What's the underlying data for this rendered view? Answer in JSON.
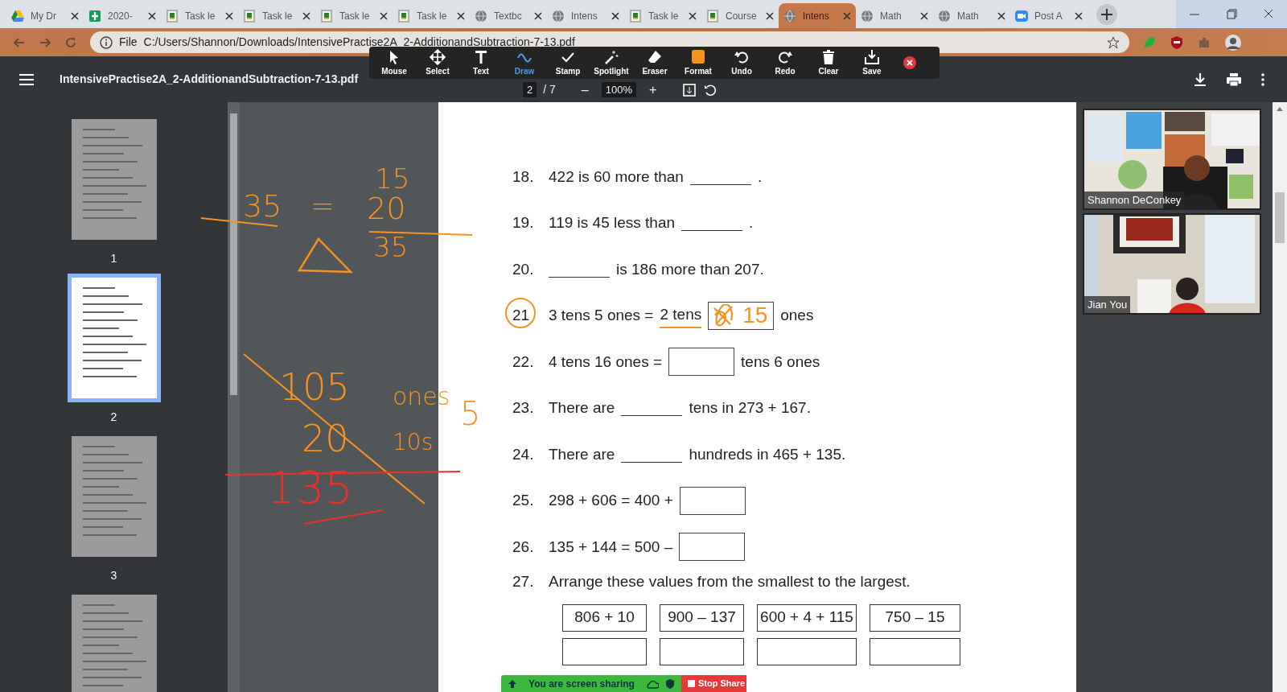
{
  "browser": {
    "tabs": [
      {
        "title": "My Dr",
        "selected": false
      },
      {
        "title": "2020-",
        "selected": false
      },
      {
        "title": "Task le",
        "selected": false
      },
      {
        "title": "Task le",
        "selected": false
      },
      {
        "title": "Task le",
        "selected": false
      },
      {
        "title": "Task le",
        "selected": false
      },
      {
        "title": "Textbc",
        "selected": false
      },
      {
        "title": "Intens",
        "selected": false
      },
      {
        "title": "Task le",
        "selected": false
      },
      {
        "title": "Course",
        "selected": false
      },
      {
        "title": "Intens",
        "selected": true
      },
      {
        "title": "Math",
        "selected": false
      },
      {
        "title": "Math",
        "selected": false
      },
      {
        "title": "Post A",
        "selected": false
      }
    ],
    "address": {
      "scheme": "File",
      "url": "C:/Users/Shannon/Downloads/IntensivePractise2A_2-AdditionandSubtraction-7-13.pdf"
    }
  },
  "zoom_toolbar": {
    "tools": [
      {
        "label": "Mouse",
        "selected": false
      },
      {
        "label": "Select",
        "selected": false
      },
      {
        "label": "Text",
        "selected": false
      },
      {
        "label": "Draw",
        "selected": true
      },
      {
        "label": "Stamp",
        "selected": false
      },
      {
        "label": "Spotlight",
        "selected": false
      },
      {
        "label": "Eraser",
        "selected": false
      },
      {
        "label": "Format",
        "selected": false
      },
      {
        "label": "Undo",
        "selected": false
      },
      {
        "label": "Redo",
        "selected": false
      },
      {
        "label": "Clear",
        "selected": false
      },
      {
        "label": "Save",
        "selected": false
      }
    ]
  },
  "pdf_viewer": {
    "title": "IntensivePractise2A_2-AdditionandSubtraction-7-13.pdf",
    "page": "2",
    "page_total": "/ 7",
    "zoom": "100%",
    "zoom_out": "–",
    "zoom_in": "+"
  },
  "thumbnails": [
    {
      "label": "1",
      "selected": false
    },
    {
      "label": "2",
      "selected": true
    },
    {
      "label": "3",
      "selected": false
    },
    {
      "selected": false
    }
  ],
  "worksheet": {
    "questions": [
      {
        "number": "18.",
        "circled": false,
        "parts": [
          {
            "kind": "text",
            "text": "422 is 60 more than",
            "underlined": false
          },
          {
            "kind": "blank"
          },
          {
            "kind": "text",
            "text": ".",
            "underlined": false
          }
        ]
      },
      {
        "number": "19.",
        "circled": false,
        "parts": [
          {
            "kind": "text",
            "text": "119 is 45 less than",
            "underlined": false
          },
          {
            "kind": "blank"
          },
          {
            "kind": "text",
            "text": ".",
            "underlined": false
          }
        ]
      },
      {
        "number": "20.",
        "circled": false,
        "parts": [
          {
            "kind": "blank"
          },
          {
            "kind": "text",
            "text": "is 186 more than 207.",
            "underlined": false
          }
        ]
      },
      {
        "number": "21",
        "circled": true,
        "parts": [
          {
            "kind": "text",
            "text": "3 tens 5 ones =",
            "underlined": false
          },
          {
            "kind": "text",
            "text": "2 tens",
            "underlined": true
          },
          {
            "kind": "box",
            "value": "15",
            "scribbled": true
          },
          {
            "kind": "text",
            "text": "ones",
            "underlined": false
          }
        ]
      },
      {
        "number": "22.",
        "circled": false,
        "parts": [
          {
            "kind": "text",
            "text": "4 tens 16 ones =",
            "underlined": false
          },
          {
            "kind": "box",
            "scribbled": false
          },
          {
            "kind": "text",
            "text": "tens 6 ones",
            "underlined": false
          }
        ]
      },
      {
        "number": "23.",
        "circled": false,
        "parts": [
          {
            "kind": "text",
            "text": "There are",
            "underlined": false
          },
          {
            "kind": "blank"
          },
          {
            "kind": "text",
            "text": "tens in 273 + 167.",
            "underlined": false
          }
        ]
      },
      {
        "number": "24.",
        "circled": false,
        "parts": [
          {
            "kind": "text",
            "text": "There are",
            "underlined": false
          },
          {
            "kind": "blank"
          },
          {
            "kind": "text",
            "text": "hundreds in 465 + 135.",
            "underlined": false
          }
        ]
      },
      {
        "number": "25.",
        "circled": false,
        "parts": [
          {
            "kind": "text",
            "text": "298 + 606 = 400 +",
            "underlined": false
          },
          {
            "kind": "box",
            "scribbled": false
          }
        ]
      },
      {
        "number": "26.",
        "circled": false,
        "parts": [
          {
            "kind": "text",
            "text": "135 + 144 = 500 –",
            "underlined": false
          },
          {
            "kind": "box",
            "scribbled": false
          }
        ]
      },
      {
        "number": "27.",
        "circled": false,
        "parts": [
          {
            "kind": "text",
            "text": "Arrange these values from the smallest to the largest.",
            "underlined": false
          }
        ],
        "value_boxes": [
          "806 + 10",
          "900 – 137",
          "600 + 4 + 115",
          "750 – 15"
        ]
      }
    ]
  },
  "annotations": [
    {
      "kind": "text",
      "text": "15",
      "color": "#f7931e"
    },
    {
      "kind": "text",
      "text": "35",
      "color": "#f7931e"
    },
    {
      "kind": "text",
      "text": "=",
      "color": "#f7931e"
    },
    {
      "kind": "text",
      "text": "20",
      "color": "#f7931e"
    },
    {
      "kind": "text",
      "text": "35",
      "color": "#f7931e"
    },
    {
      "kind": "line",
      "color": "#f7931e"
    },
    {
      "kind": "line",
      "color": "#f7931e"
    },
    {
      "kind": "triangle",
      "color": "#f7931e"
    },
    {
      "kind": "text",
      "text": "105",
      "color": "#f7931e"
    },
    {
      "kind": "text",
      "text": "ones",
      "color": "#f7931e"
    },
    {
      "kind": "text",
      "text": "5",
      "color": "#f7931e"
    },
    {
      "kind": "text",
      "text": "20",
      "color": "#f7931e"
    },
    {
      "kind": "text",
      "text": "10s",
      "color": "#f7931e"
    },
    {
      "kind": "line",
      "color": "#f7931e"
    },
    {
      "kind": "line",
      "color": "#e8312a"
    },
    {
      "kind": "text",
      "text": "135",
      "color": "#e8312a"
    },
    {
      "kind": "line",
      "color": "#e8312a"
    }
  ],
  "participants": [
    {
      "name": "Shannon DeConkey"
    },
    {
      "name": "Jian You"
    }
  ],
  "share_bar": {
    "status": "You are screen sharing",
    "stop": "Stop Share"
  }
}
